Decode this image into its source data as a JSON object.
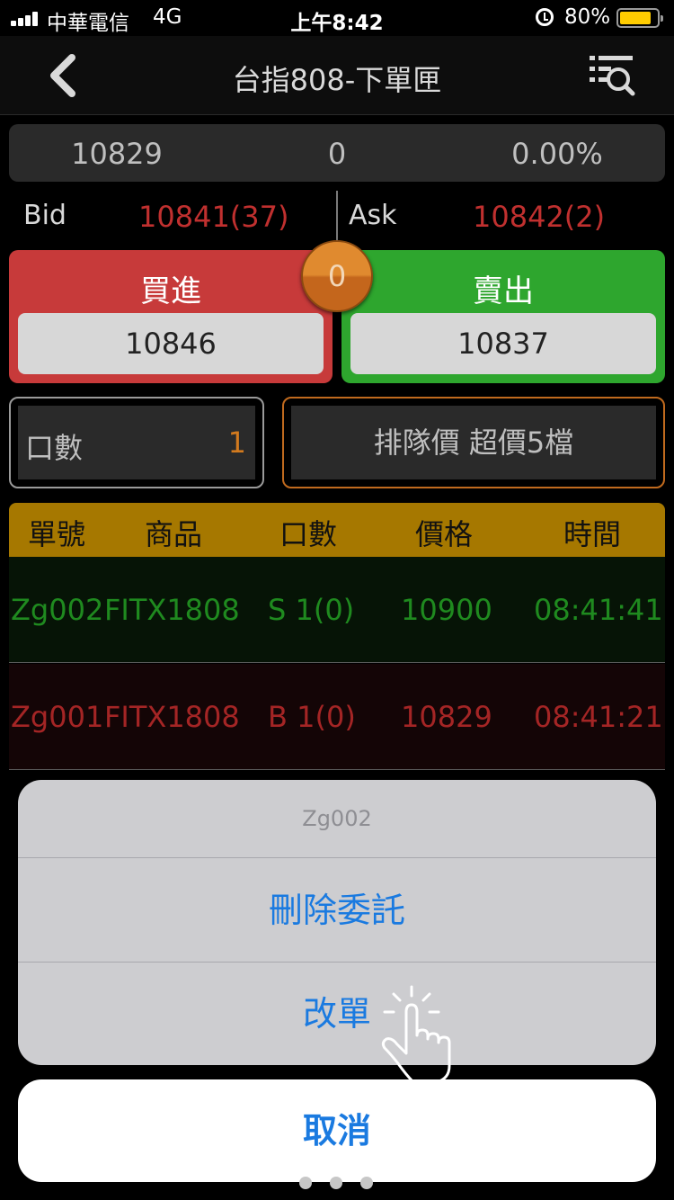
{
  "status_bar": {
    "carrier": "中華電信",
    "network": "4G",
    "time": "上午8:42",
    "battery_percent": "80%",
    "battery_level": 0.8
  },
  "nav": {
    "title": "台指808-下單匣",
    "back_icon": "chevron-left-icon",
    "filter_icon": "list-search-icon"
  },
  "quote": {
    "last": "10829",
    "change": "0",
    "change_pct": "0.00%"
  },
  "bid_ask": {
    "bid_label": "Bid",
    "bid_value": "10841(37)",
    "ask_label": "Ask",
    "ask_value": "10842(2)"
  },
  "trade": {
    "buy_label": "買進",
    "buy_price": "10846",
    "sell_label": "賣出",
    "sell_price": "10837",
    "position": "0"
  },
  "order_form": {
    "qty_label": "口數",
    "qty_value": "1",
    "order_type": "排隊價 超價5檔"
  },
  "orders_table": {
    "headers": [
      "單號",
      "商品",
      "口數",
      "價格",
      "時間"
    ],
    "rows": [
      {
        "id": "Zg002",
        "product": "FITX1808",
        "qty": "S 1(0)",
        "price": "10900",
        "time": "08:41:41"
      },
      {
        "id": "Zg001",
        "product": "FITX1808",
        "qty": "B 1(0)",
        "price": "10829",
        "time": "08:41:21"
      }
    ]
  },
  "action_sheet": {
    "title": "Zg002",
    "delete_label": "刪除委託",
    "modify_label": "改單",
    "cancel_label": "取消"
  },
  "colors": {
    "buy": "#c73a3a",
    "sell": "#2ea62e",
    "header_gold": "#a67800",
    "action_blue": "#1a7ae0"
  }
}
